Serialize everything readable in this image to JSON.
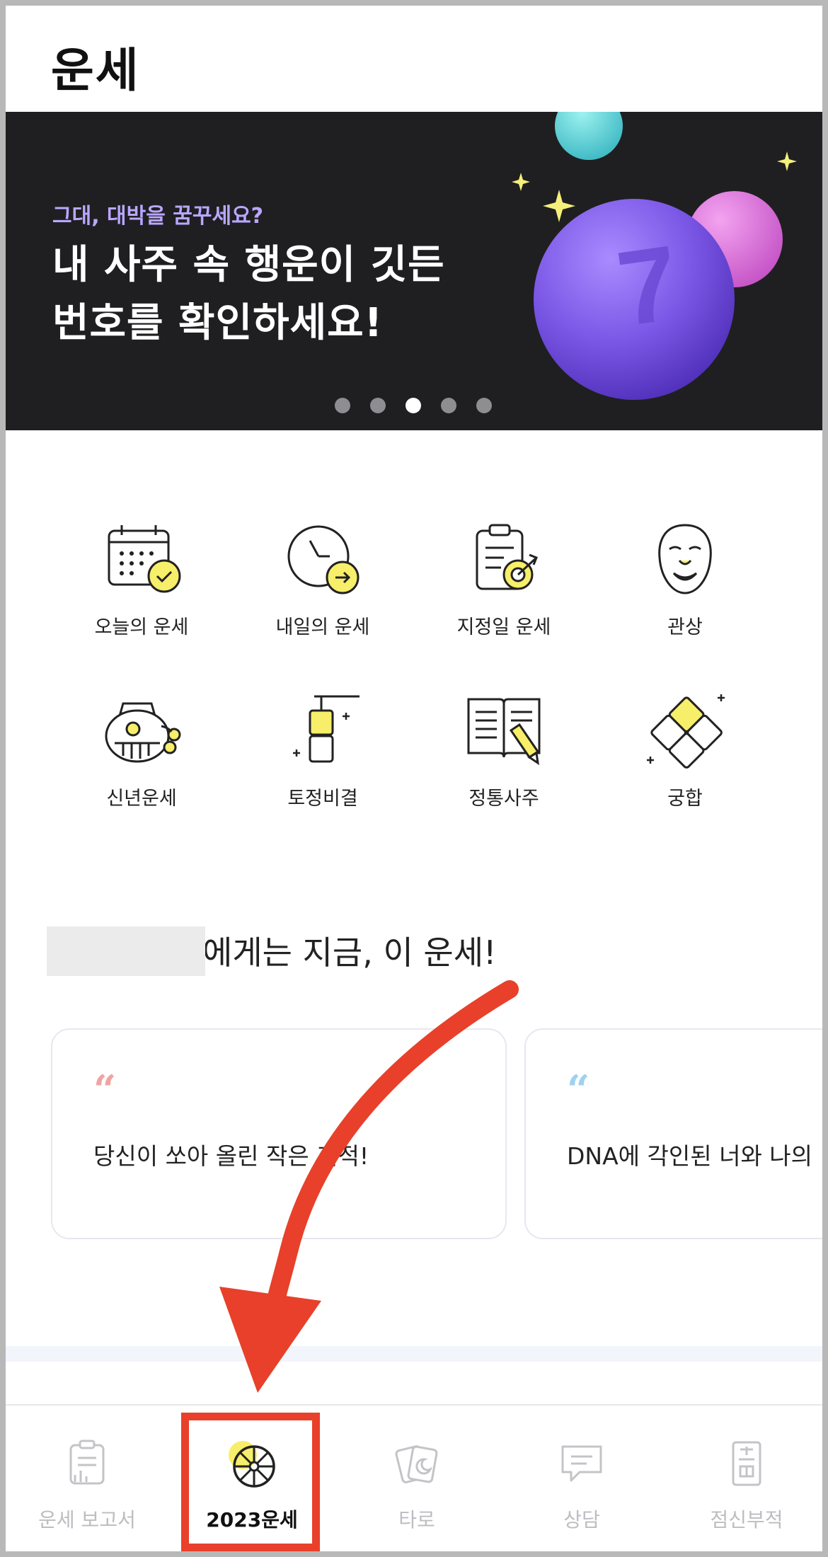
{
  "header": {
    "title": "운세"
  },
  "banner": {
    "subtitle": "그대, 대박을 꿈꾸세요?",
    "title_line1": "내 사주 속 행운이 깃든",
    "title_line2": "번호를 확인하세요!",
    "ball_number": "7",
    "pager": {
      "count": 5,
      "active_index": 3
    },
    "colors": {
      "background": "#1f1f21",
      "subtitle": "#b9a7ff",
      "ball": "#7b57e6"
    }
  },
  "menu": {
    "items": [
      {
        "label": "오늘의 운세",
        "icon": "calendar-check-icon"
      },
      {
        "label": "내일의 운세",
        "icon": "clock-arrow-icon"
      },
      {
        "label": "지정일 운세",
        "icon": "clipboard-target-icon"
      },
      {
        "label": "관상",
        "icon": "face-mask-icon"
      },
      {
        "label": "신년운세",
        "icon": "lucky-pouch-icon"
      },
      {
        "label": "토정비결",
        "icon": "scroll-icon"
      },
      {
        "label": "정통사주",
        "icon": "book-pencil-icon"
      },
      {
        "label": "궁합",
        "icon": "puzzle-icon"
      }
    ]
  },
  "recommend": {
    "title_suffix": "에게는 지금, 이 운세!",
    "cards": [
      {
        "text": "당신이 쏘아 올린 작은 기적!",
        "quote_color": "#f0a4a0"
      },
      {
        "text": "DNA에 각인된 너와 나의 ",
        "quote_color": "#9fd2f0"
      }
    ]
  },
  "tabbar": {
    "tabs": [
      {
        "label": "운세 보고서",
        "icon": "report-icon"
      },
      {
        "label": "2023운세",
        "icon": "fortune-wheel-icon",
        "active": true
      },
      {
        "label": "타로",
        "icon": "tarot-moon-icon"
      },
      {
        "label": "상담",
        "icon": "chat-bubble-icon"
      },
      {
        "label": "점신부적",
        "icon": "talisman-icon"
      }
    ],
    "active_color": "#111111",
    "inactive_color": "#bdbdc2"
  },
  "annotation": {
    "highlight_color": "#e8402a"
  }
}
